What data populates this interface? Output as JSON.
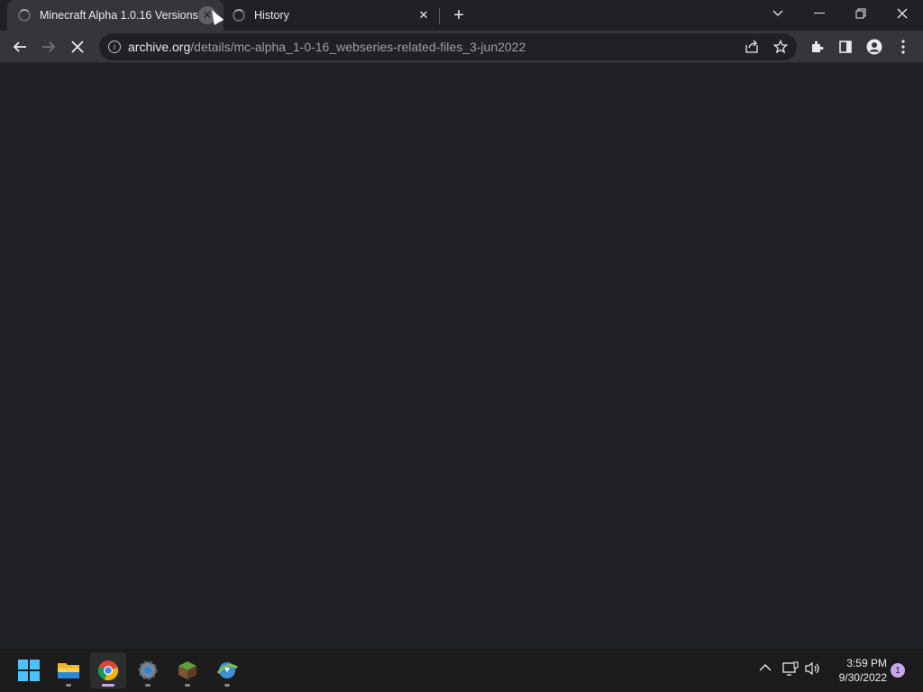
{
  "browser": {
    "tabs": [
      {
        "title": "Minecraft Alpha 1.0.16 Versions (",
        "active": true
      },
      {
        "title": "History",
        "active": false
      }
    ],
    "new_tab_label": "+",
    "window_controls": {
      "dropdown": "⌄",
      "minimize": "—",
      "restore": "❐",
      "close": "✕"
    }
  },
  "toolbar": {
    "back": "←",
    "forward": "→",
    "stop": "✕",
    "url_host": "archive.org",
    "url_path": "/details/mc-alpha_1-0-16_webseries-related-files_3-jun2022",
    "share_icon": "share-icon",
    "bookmark_icon": "star-icon",
    "extensions_icon": "puzzle-icon",
    "sidepanel_icon": "side-panel-icon",
    "profile_icon": "profile-icon",
    "menu_icon": "kebab-menu-icon"
  },
  "taskbar": {
    "apps": [
      {
        "name": "start-button",
        "active": false
      },
      {
        "name": "file-explorer",
        "active": false
      },
      {
        "name": "chrome",
        "active": true
      },
      {
        "name": "settings",
        "active": false
      },
      {
        "name": "minecraft",
        "active": false
      },
      {
        "name": "internet-download-manager",
        "active": false
      }
    ],
    "time": "3:59 PM",
    "date": "9/30/2022",
    "notification_count": "1"
  },
  "colors": {
    "tab_active": "#35363a",
    "background": "#202124",
    "taskbar": "#1c1c1c",
    "accent": "#c9a7ef"
  }
}
